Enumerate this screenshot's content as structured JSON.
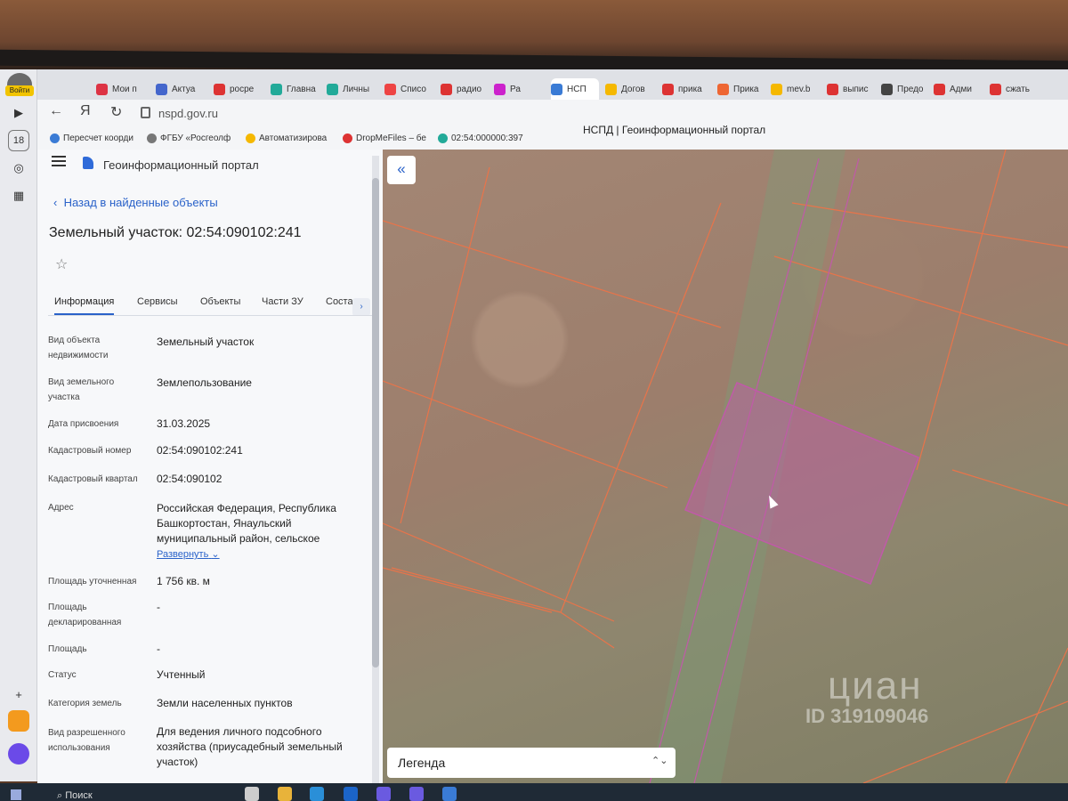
{
  "browser": {
    "login_badge": "Войти",
    "url": "nspd.gov.ru",
    "page_title": "НСПД | Геоинформационный портал",
    "rail_badge": "18",
    "tabs": [
      {
        "label": "Мои п",
        "color": "#d34"
      },
      {
        "label": "Актуа",
        "color": "#4466cc"
      },
      {
        "label": "росре",
        "color": "#d33"
      },
      {
        "label": "Главна",
        "color": "#2a9"
      },
      {
        "label": "Личны",
        "color": "#2a9"
      },
      {
        "label": "Списо",
        "color": "#e44"
      },
      {
        "label": "радио",
        "color": "#d33"
      },
      {
        "label": "Ра",
        "color": "#c2c"
      },
      {
        "label": "НСП",
        "color": "#3a7bd5"
      },
      {
        "label": "Догов",
        "color": "#f5b800"
      },
      {
        "label": "прика",
        "color": "#d33"
      },
      {
        "label": "Прика",
        "color": "#e63"
      },
      {
        "label": "mev.b",
        "color": "#f5b800"
      },
      {
        "label": "выпис",
        "color": "#d33"
      },
      {
        "label": "Предо",
        "color": "#444"
      },
      {
        "label": "Адми",
        "color": "#d33"
      },
      {
        "label": "сжать",
        "color": "#d33"
      }
    ],
    "bookmarks": [
      {
        "label": "Пересчет коорди",
        "color": "#3a7bd5"
      },
      {
        "label": "ФГБУ «Росгеолф",
        "color": "#777"
      },
      {
        "label": "Автоматизирова",
        "color": "#f5b800"
      },
      {
        "label": "DropMeFiles – бе",
        "color": "#d33"
      },
      {
        "label": "02:54:000000:397",
        "color": "#2a9"
      }
    ]
  },
  "portal": {
    "name": "Геоинформационный портал",
    "back_link": "Назад в найденные объекты",
    "object_title": "Земельный участок: 02:54:090102:241",
    "tabs": [
      "Информация",
      "Сервисы",
      "Объекты",
      "Части ЗУ",
      "Соста"
    ],
    "tabs_more": "›",
    "properties": [
      {
        "label": "Вид объекта недвижимости",
        "value": "Земельный участок"
      },
      {
        "label": "Вид земельного участка",
        "value": "Землепользование"
      },
      {
        "label": "Дата присвоения",
        "value": "31.03.2025"
      },
      {
        "label": "Кадастровый номер",
        "value": "02:54:090102:241"
      },
      {
        "label": "Кадастровый квартал",
        "value": "02:54:090102"
      },
      {
        "label": "Адрес",
        "value": "Российская Федерация, Республика Башкортостан, Янаульский муниципальный район, сельское"
      },
      {
        "label": "Площадь уточненная",
        "value": "1 756 кв. м"
      },
      {
        "label": "Площадь декларированная",
        "value": "-"
      },
      {
        "label": "Площадь",
        "value": "-"
      },
      {
        "label": "Статус",
        "value": "Учтенный"
      },
      {
        "label": "Категория земель",
        "value": "Земли населенных пунктов"
      },
      {
        "label": "Вид разрешенного использования",
        "value": "Для ведения личного подсобного хозяйства (приусадебный земельный участок)"
      }
    ],
    "expand_label": "Развернуть"
  },
  "map": {
    "collapse_icon": "«",
    "legend_label": "Легенда",
    "legend_toggle": "⌃⌄",
    "watermark_brand": "циан",
    "watermark_id": "ID 319109046",
    "parcel_color": "#c05aa8",
    "boundary_color": "#e8744a"
  },
  "taskbar": {
    "search_label": "Поиск"
  }
}
